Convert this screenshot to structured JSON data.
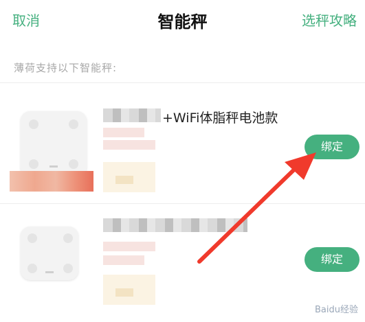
{
  "nav": {
    "cancel_label": "取消",
    "title": "智能秤",
    "guide_label": "选秤攻略"
  },
  "section": {
    "label": "薄荷支持以下智能秤:"
  },
  "devices": [
    {
      "name_visible": "+WiFi体脂秤电池款",
      "bind_label": "绑定",
      "thumb_icon": "smart-scale-icon"
    },
    {
      "bind_label": "绑定",
      "thumb_icon": "smart-scale-icon"
    }
  ],
  "watermark": {
    "text": "Baidu经验"
  },
  "colors": {
    "accent": "#45b07f",
    "arrow": "#f03a2c"
  }
}
